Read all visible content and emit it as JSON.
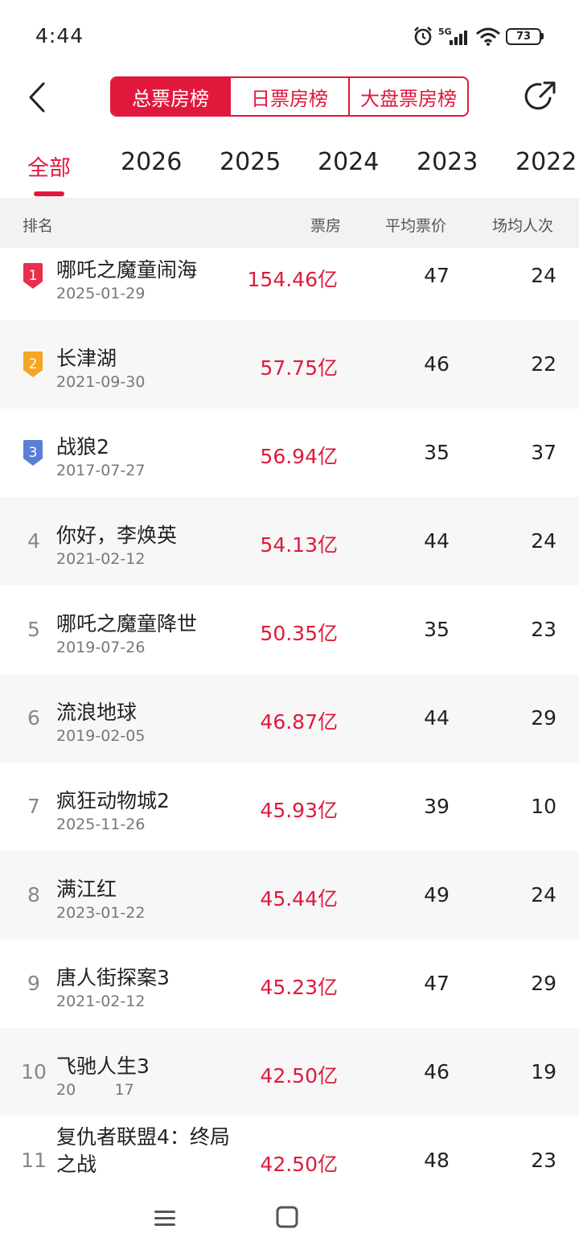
{
  "status": {
    "time": "4:44",
    "network": "5G",
    "battery": "73"
  },
  "header": {
    "tabs": [
      {
        "label": "总票房榜",
        "active": true
      },
      {
        "label": "日票房榜",
        "active": false
      },
      {
        "label": "大盘票房榜",
        "active": false
      }
    ],
    "back_icon": "chevron-left-icon",
    "share_icon": "share-arrow-icon"
  },
  "year_tabs": [
    "全部",
    "2026",
    "2025",
    "2024",
    "2023",
    "2022"
  ],
  "columns": {
    "rank": "排名",
    "gross": "票房",
    "avg_price": "平均票价",
    "avg_attendance": "场均人次"
  },
  "rows": [
    {
      "rank": "1",
      "title": "哪吒之魔童闹海",
      "date": "2025-01-29",
      "gross": "154.46亿",
      "avg_price": "47",
      "avg_attendance": "24"
    },
    {
      "rank": "2",
      "title": "长津湖",
      "date": "2021-09-30",
      "gross": "57.75亿",
      "avg_price": "46",
      "avg_attendance": "22"
    },
    {
      "rank": "3",
      "title": "战狼2",
      "date": "2017-07-27",
      "gross": "56.94亿",
      "avg_price": "35",
      "avg_attendance": "37"
    },
    {
      "rank": "4",
      "title": "你好，李焕英",
      "date": "2021-02-12",
      "gross": "54.13亿",
      "avg_price": "44",
      "avg_attendance": "24"
    },
    {
      "rank": "5",
      "title": "哪吒之魔童降世",
      "date": "2019-07-26",
      "gross": "50.35亿",
      "avg_price": "35",
      "avg_attendance": "23"
    },
    {
      "rank": "6",
      "title": "流浪地球",
      "date": "2019-02-05",
      "gross": "46.87亿",
      "avg_price": "44",
      "avg_attendance": "29"
    },
    {
      "rank": "7",
      "title": "疯狂动物城2",
      "date": "2025-11-26",
      "gross": "45.93亿",
      "avg_price": "39",
      "avg_attendance": "10"
    },
    {
      "rank": "8",
      "title": "满江红",
      "date": "2023-01-22",
      "gross": "45.44亿",
      "avg_price": "49",
      "avg_attendance": "24"
    },
    {
      "rank": "9",
      "title": "唐人街探案3",
      "date": "2021-02-12",
      "gross": "45.23亿",
      "avg_price": "47",
      "avg_attendance": "29"
    },
    {
      "rank": "10",
      "title": "飞驰人生3",
      "date": "20        17",
      "gross": "42.50亿",
      "avg_price": "46",
      "avg_attendance": "19"
    },
    {
      "rank": "11",
      "title": "复仇者联盟4：终局",
      "title2": "之战",
      "date": "",
      "gross": "42.50亿",
      "avg_price": "48",
      "avg_attendance": "23"
    }
  ],
  "colors": {
    "accent": "#e0193c",
    "gold": "#f5a623",
    "blue": "#5b7fd6"
  }
}
